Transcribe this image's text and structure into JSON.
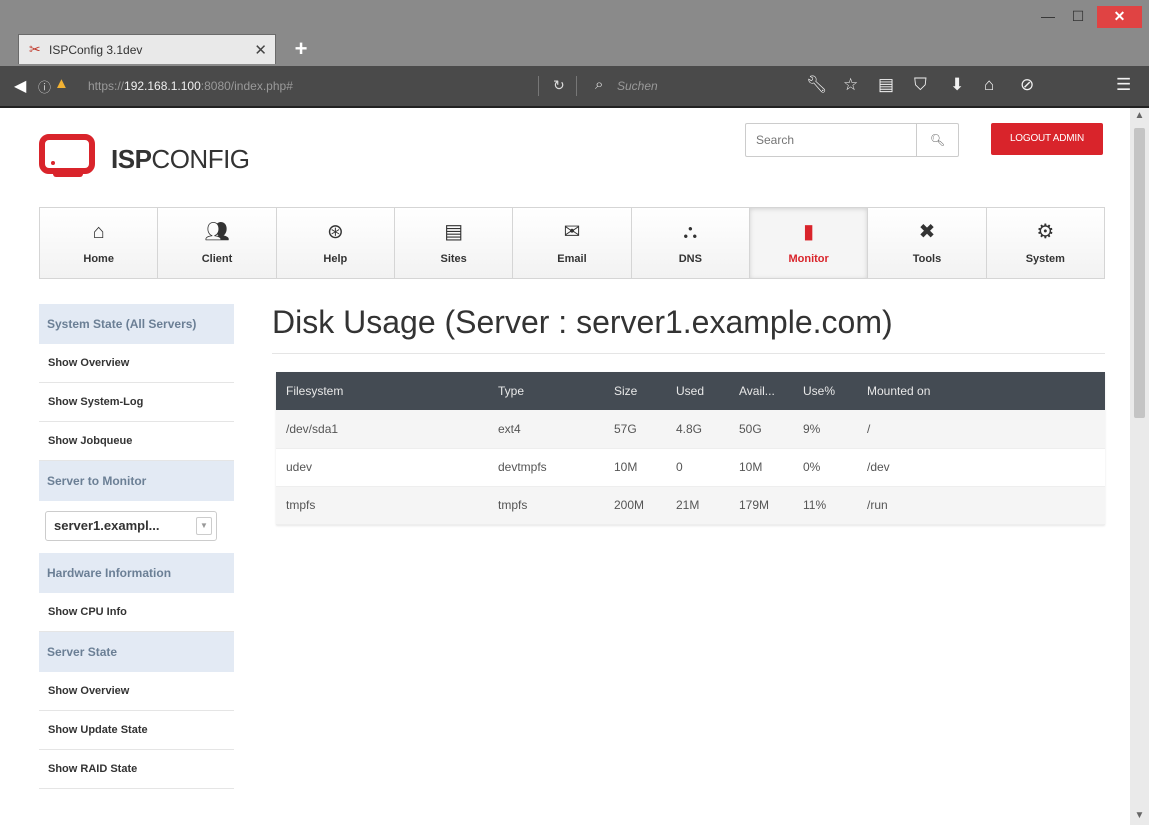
{
  "browser": {
    "tab_title": "ISPConfig 3.1dev",
    "url_prefix": "https://",
    "url_host": "192.168.1.100",
    "url_rest": ":8080/index.php#",
    "search_placeholder": "Suchen"
  },
  "header": {
    "logo_bold": "ISP",
    "logo_light": "CONFIG",
    "search_placeholder": "Search",
    "logout_label": "LOGOUT ADMIN"
  },
  "mainnav": {
    "items": [
      {
        "label": "Home",
        "icon": "home-icon"
      },
      {
        "label": "Client",
        "icon": "users-icon"
      },
      {
        "label": "Help",
        "icon": "lifebuoy-icon"
      },
      {
        "label": "Sites",
        "icon": "browser-window-icon"
      },
      {
        "label": "Email",
        "icon": "envelope-icon"
      },
      {
        "label": "DNS",
        "icon": "network-icon"
      },
      {
        "label": "Monitor",
        "icon": "monitor-meter-icon",
        "active": true
      },
      {
        "label": "Tools",
        "icon": "tools-icon"
      },
      {
        "label": "System",
        "icon": "gear-icon"
      }
    ]
  },
  "sidebar": {
    "section1_title": "System State (All Servers)",
    "section1_items": [
      "Show Overview",
      "Show System-Log",
      "Show Jobqueue"
    ],
    "section2_title": "Server to Monitor",
    "server_select_value": "server1.exampl...",
    "section3_title": "Hardware Information",
    "section3_items": [
      "Show CPU Info"
    ],
    "section4_title": "Server State",
    "section4_items": [
      "Show Overview",
      "Show Update State",
      "Show RAID State"
    ]
  },
  "content": {
    "title": "Disk Usage (Server : server1.example.com)",
    "table": {
      "headers": [
        "Filesystem",
        "Type",
        "Size",
        "Used",
        "Avail...",
        "Use%",
        "Mounted on"
      ],
      "rows": [
        [
          "/dev/sda1",
          "ext4",
          "57G",
          "4.8G",
          "50G",
          "9%",
          "/"
        ],
        [
          "udev",
          "devtmpfs",
          "10M",
          "0",
          "10M",
          "0%",
          "/dev"
        ],
        [
          "tmpfs",
          "tmpfs",
          "200M",
          "21M",
          "179M",
          "11%",
          "/run"
        ]
      ]
    }
  },
  "colors": {
    "accent_red": "#d9242b",
    "table_header": "#444b53",
    "sidebar_header": "#e3eaf4"
  }
}
